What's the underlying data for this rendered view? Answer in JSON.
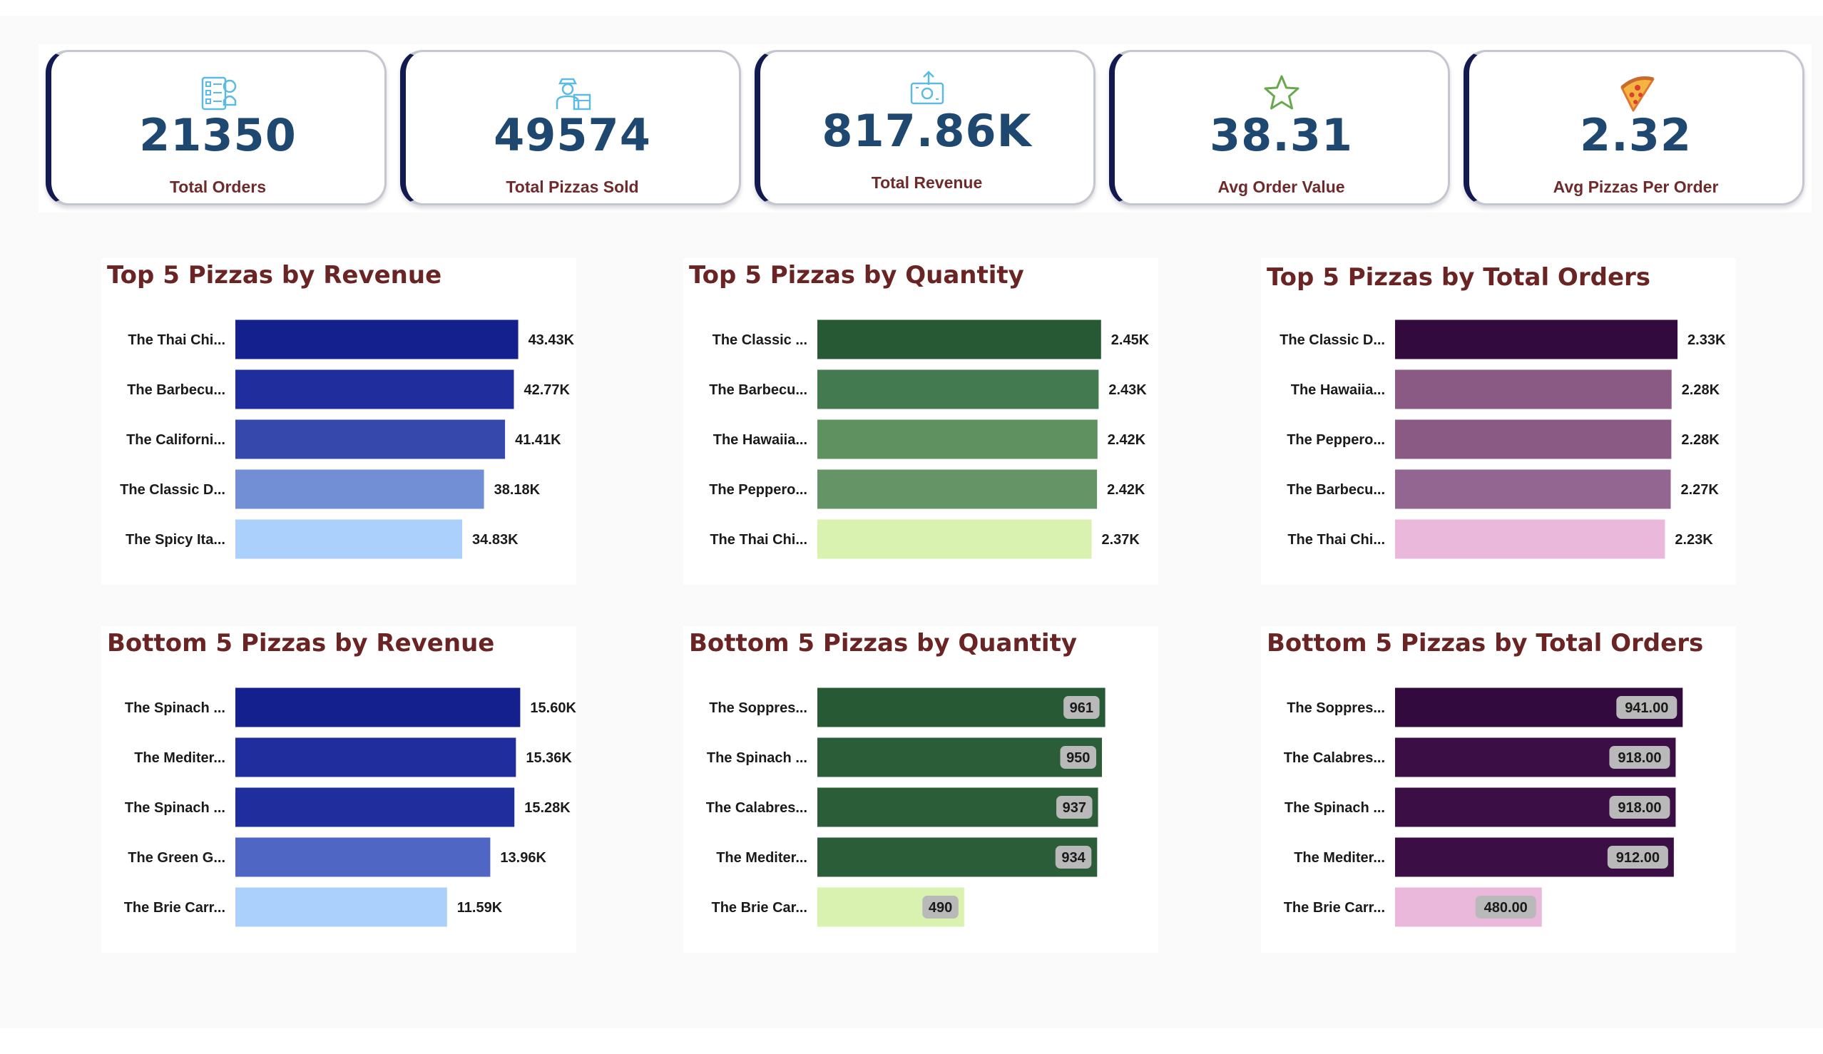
{
  "kpis": [
    {
      "value": "21350",
      "label": "Total Orders",
      "icon": "order-list-icon"
    },
    {
      "value": "49574",
      "label": "Total Pizzas Sold",
      "icon": "delivery-person-icon"
    },
    {
      "value": "817.86K",
      "label": "Total Revenue",
      "icon": "money-upload-icon"
    },
    {
      "value": "38.31",
      "label": "Avg Order Value",
      "icon": "star-icon"
    },
    {
      "value": "2.32",
      "label": "Avg Pizzas Per Order",
      "icon": "pizza-slice-icon"
    }
  ],
  "chart_data": [
    {
      "type": "bar",
      "orientation": "horizontal",
      "title": "Top 5 Pizzas by Revenue",
      "categories": [
        "The Thai Chi...",
        "The Barbecu...",
        "The Californi...",
        "The Classic D...",
        "The Spicy Ita..."
      ],
      "values": [
        43434,
        42768,
        41410,
        38180,
        34831
      ],
      "labels": [
        "43.43K",
        "42.77K",
        "41.41K",
        "38.18K",
        "34.83K"
      ],
      "colors": [
        "#15208f",
        "#1f2e9c",
        "#3648ac",
        "#728fd6",
        "#abd0fb"
      ],
      "label_style": "outside",
      "xlim": [
        0,
        46000
      ]
    },
    {
      "type": "bar",
      "orientation": "horizontal",
      "title": "Top 5 Pizzas by Quantity",
      "categories": [
        "The Classic ...",
        "The Barbecu...",
        "The Hawaiia...",
        "The Peppero...",
        "The Thai Chi..."
      ],
      "values": [
        2453,
        2432,
        2422,
        2418,
        2371
      ],
      "labels": [
        "2.45K",
        "2.43K",
        "2.42K",
        "2.42K",
        "2.37K"
      ],
      "colors": [
        "#265934",
        "#437a50",
        "#5e9060",
        "#659566",
        "#d9f2b0"
      ],
      "label_style": "outside",
      "xlim": [
        0,
        2590
      ]
    },
    {
      "type": "bar",
      "orientation": "horizontal",
      "title": "Top 5 Pizzas by Total Orders",
      "categories": [
        "The Classic D...",
        "The Hawaiia...",
        "The Peppero...",
        "The Barbecu...",
        "The Thai Chi..."
      ],
      "values": [
        2329,
        2280,
        2278,
        2273,
        2225
      ],
      "labels": [
        "2.33K",
        "2.28K",
        "2.28K",
        "2.27K",
        "2.23K"
      ],
      "colors": [
        "#330a3e",
        "#8a5a85",
        "#8a5a85",
        "#936591",
        "#e9b8da"
      ],
      "label_style": "outside",
      "xlim": [
        0,
        2470
      ]
    },
    {
      "type": "bar",
      "orientation": "horizontal",
      "title": "Bottom 5 Pizzas by Revenue",
      "categories": [
        "The Spinach ...",
        "The Mediter...",
        "The Spinach ...",
        "The Green G...",
        "The Brie Carr..."
      ],
      "values": [
        15596,
        15360,
        15277,
        13956,
        11588
      ],
      "labels": [
        "15.60K",
        "15.36K",
        "15.28K",
        "13.96K",
        "11.59K"
      ],
      "colors": [
        "#15208f",
        "#1f2e9c",
        "#1f2e9c",
        "#5066c4",
        "#abd0fb"
      ],
      "label_style": "outside",
      "xlim": [
        0,
        16400
      ]
    },
    {
      "type": "bar",
      "orientation": "horizontal",
      "title": "Bottom 5 Pizzas by Quantity",
      "categories": [
        "The Soppres...",
        "The Spinach ...",
        "The Calabres...",
        "The Mediter...",
        "The Brie Car..."
      ],
      "values": [
        961,
        950,
        937,
        934,
        490
      ],
      "labels": [
        "961",
        "950",
        "937",
        "934",
        "490"
      ],
      "colors": [
        "#265934",
        "#2b5e38",
        "#2b5e38",
        "#2b5e38",
        "#d9f2b0"
      ],
      "label_style": "inside",
      "xlim": [
        0,
        1000
      ]
    },
    {
      "type": "bar",
      "orientation": "horizontal",
      "title": "Bottom 5 Pizzas by Total Orders",
      "categories": [
        "The Soppres...",
        "The Calabres...",
        "The Spinach ...",
        "The Mediter...",
        "The Brie Carr..."
      ],
      "values": [
        941,
        918,
        918,
        912,
        480
      ],
      "labels": [
        "941.00",
        "918.00",
        "918.00",
        "912.00",
        "480.00"
      ],
      "colors": [
        "#330a3e",
        "#3b0f45",
        "#3b0f45",
        "#3b0f45",
        "#e9b8da"
      ],
      "label_style": "inside",
      "xlim": [
        0,
        980
      ]
    }
  ]
}
